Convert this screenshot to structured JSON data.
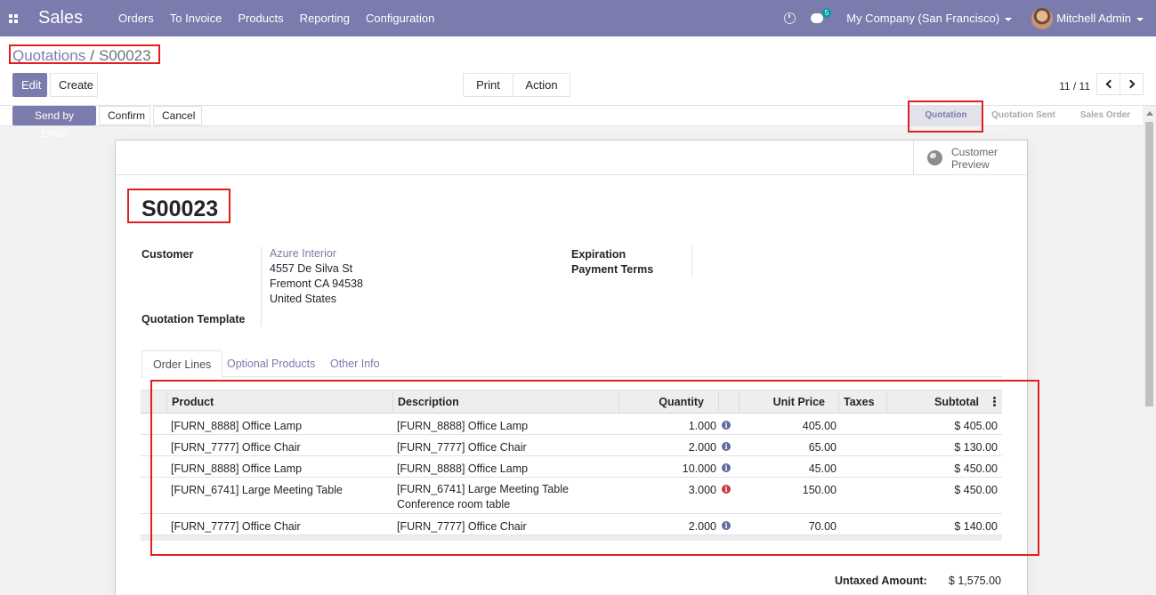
{
  "navbar": {
    "app_name": "Sales",
    "menu": [
      "Orders",
      "To Invoice",
      "Products",
      "Reporting",
      "Configuration"
    ],
    "chat_count": "5",
    "company": "My Company (San Francisco)",
    "user": "Mitchell Admin",
    "color": "#7c7bad"
  },
  "breadcrumb": {
    "parent": "Quotations",
    "separator": "/",
    "current": "S00023"
  },
  "buttons": {
    "edit": "Edit",
    "create": "Create",
    "print": "Print",
    "action": "Action"
  },
  "pager": {
    "value": "11 / 11"
  },
  "header_buttons": {
    "send_email": "Send by Email",
    "confirm": "Confirm",
    "cancel": "Cancel"
  },
  "status": {
    "stages": [
      "Quotation",
      "Quotation Sent",
      "Sales Order"
    ],
    "active": "Quotation"
  },
  "sheet": {
    "preview_label": "Customer Preview",
    "title": "S00023",
    "fields": {
      "customer_label": "Customer",
      "customer_name": "Azure Interior",
      "address": [
        "4557 De Silva St",
        "Fremont CA 94538",
        "United States"
      ],
      "template_label": "Quotation Template",
      "expiration_label": "Expiration",
      "payment_terms_label": "Payment Terms"
    },
    "tabs": [
      "Order Lines",
      "Optional Products",
      "Other Info"
    ],
    "table": {
      "headers": [
        "Product",
        "Description",
        "Quantity",
        "Unit Price",
        "Taxes",
        "Subtotal"
      ],
      "rows": [
        {
          "product": "[FURN_8888] Office Lamp",
          "description": "[FURN_8888] Office Lamp",
          "description2": "",
          "quantity": "1.000",
          "unit_price": "405.00",
          "taxes": "",
          "subtotal": "$ 405.00",
          "warn": false
        },
        {
          "product": "[FURN_7777] Office Chair",
          "description": "[FURN_7777] Office Chair",
          "description2": "",
          "quantity": "2.000",
          "unit_price": "65.00",
          "taxes": "",
          "subtotal": "$ 130.00",
          "warn": false
        },
        {
          "product": "[FURN_8888] Office Lamp",
          "description": "[FURN_8888] Office Lamp",
          "description2": "",
          "quantity": "10.000",
          "unit_price": "45.00",
          "taxes": "",
          "subtotal": "$ 450.00",
          "warn": false
        },
        {
          "product": "[FURN_6741] Large Meeting Table",
          "description": "[FURN_6741] Large Meeting Table",
          "description2": "Conference room table",
          "quantity": "3.000",
          "unit_price": "150.00",
          "taxes": "",
          "subtotal": "$ 450.00",
          "warn": true
        },
        {
          "product": "[FURN_7777] Office Chair",
          "description": "[FURN_7777] Office Chair",
          "description2": "",
          "quantity": "2.000",
          "unit_price": "70.00",
          "taxes": "",
          "subtotal": "$ 140.00",
          "warn": false
        }
      ]
    },
    "totals": {
      "untaxed_label": "Untaxed Amount:",
      "untaxed_value": "$ 1,575.00"
    }
  },
  "icons": {
    "info": "info-icon",
    "globe": "globe-icon",
    "apps": "apps-grid-icon"
  }
}
